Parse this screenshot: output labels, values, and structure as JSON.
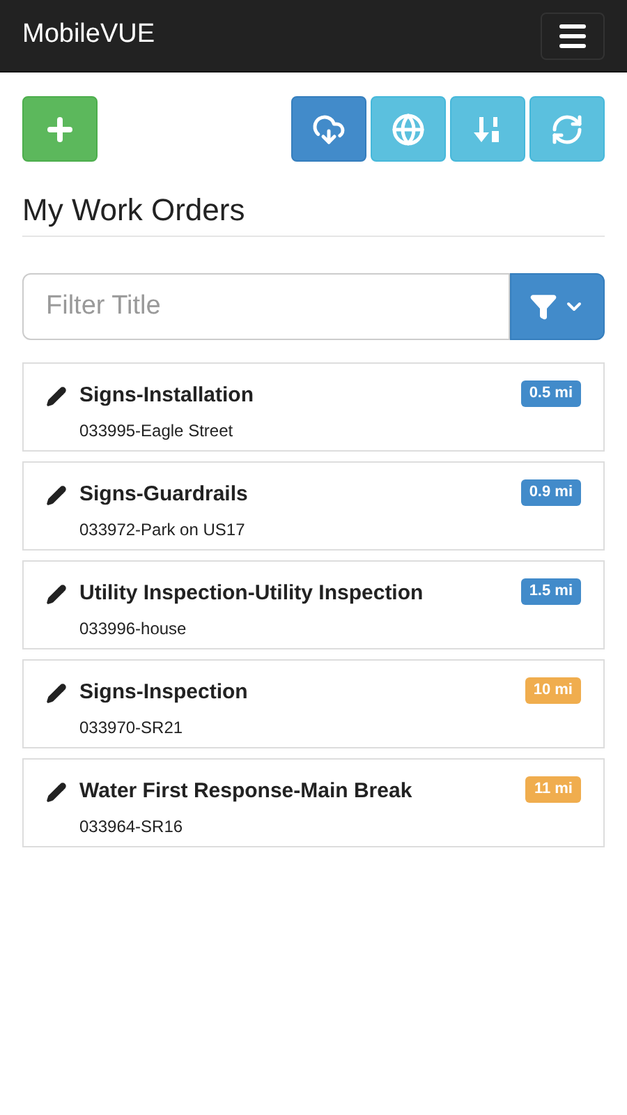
{
  "navbar": {
    "brand": "MobileVUE"
  },
  "toolbar": [
    {
      "kind": "download",
      "selected": true
    },
    {
      "kind": "globe",
      "selected": false
    },
    {
      "kind": "sort",
      "selected": false
    },
    {
      "kind": "refresh",
      "selected": false
    }
  ],
  "heading": "My Work Orders",
  "filter": {
    "placeholder": "Filter Title"
  },
  "orders": [
    {
      "title": "Signs-Installation",
      "subtitle": "033995-Eagle Street",
      "distance": "0.5 mi",
      "color": "#428bca"
    },
    {
      "title": "Signs-Guardrails",
      "subtitle": "033972-Park on US17",
      "distance": "0.9 mi",
      "color": "#428bca"
    },
    {
      "title": "Utility Inspection-Utility Inspection",
      "subtitle": "033996-house",
      "distance": "1.5 mi",
      "color": "#428bca"
    },
    {
      "title": "Signs-Inspection",
      "subtitle": "033970-SR21",
      "distance": "10 mi",
      "color": "#f0ad4e"
    },
    {
      "title": "Water First Response-Main Break",
      "subtitle": "033964-SR16",
      "distance": "11 mi",
      "color": "#f0ad4e"
    }
  ]
}
